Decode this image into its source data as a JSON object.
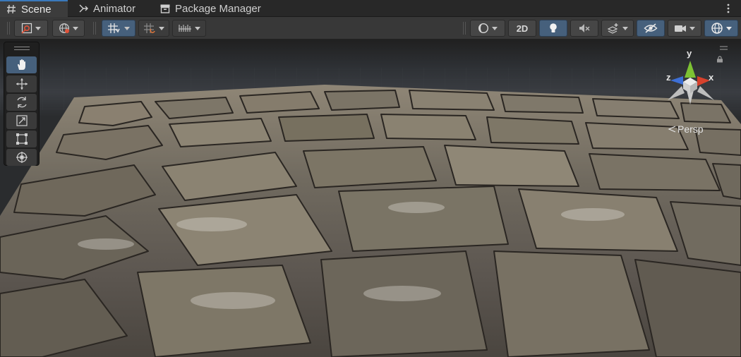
{
  "tabs": [
    {
      "label": "Scene",
      "icon": "grid-hash-icon",
      "active": true
    },
    {
      "label": "Animator",
      "icon": "animator-icon",
      "active": false
    },
    {
      "label": "Package Manager",
      "icon": "package-icon",
      "active": false
    }
  ],
  "toolbar": {
    "label_2d": "2D",
    "left_buttons": [
      "gizmo-draw-mode-icon",
      "global-local-icon",
      "grid-snapping-icon",
      "increment-snap-icon",
      "render-mode-icon"
    ],
    "right_buttons": [
      "shading-mode-icon",
      "lighting-icon",
      "audio-mute-icon",
      "effects-icon",
      "scene-visibility-icon",
      "camera-icon",
      "gizmos-icon"
    ]
  },
  "tools": [
    "hand-tool-icon",
    "move-tool-icon",
    "rotate-tool-icon",
    "scale-tool-icon",
    "rect-tool-icon",
    "transform-tool-icon"
  ],
  "gizmo": {
    "x_label": "x",
    "y_label": "y",
    "z_label": "z",
    "projection": "Persp"
  },
  "colors": {
    "accent": "#3a79bb",
    "active_button": "#46607c",
    "x_axis": "#d7412c",
    "y_axis": "#7dc233",
    "z_axis": "#3d6fd6"
  }
}
